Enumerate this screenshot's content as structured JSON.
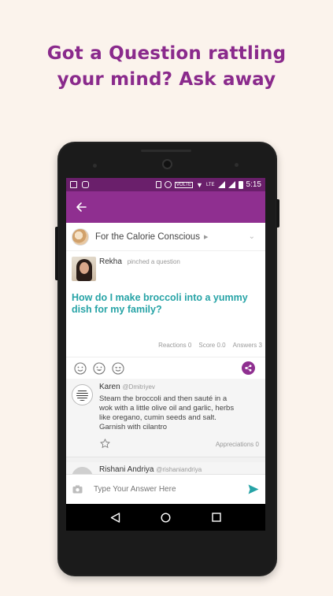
{
  "promo": {
    "line1": "Got a Question rattling",
    "line2": "your mind? Ask away"
  },
  "status_bar": {
    "time": "5:15",
    "network": "LTE",
    "volte": "VOLTE"
  },
  "app_bar": {
    "back_icon": "arrow-back-icon"
  },
  "category": {
    "name": "For the Calorie Conscious"
  },
  "post": {
    "user": "Rekha",
    "action": "pinched a question",
    "question": "How do I make broccoli into a yummy dish for my family?",
    "stats": {
      "reactions_label": "Reactions",
      "reactions_value": "0",
      "score_label": "Score",
      "score_value": "0.0",
      "answers_label": "Answers",
      "answers_value": "3"
    }
  },
  "answers": [
    {
      "name": "Karen",
      "handle": "@Dmitriyev",
      "text": "Steam the broccoli and then sauté in a wok with a little olive oil and garlic, herbs like oregano, cumin seeds and salt. Garnish with cilantro",
      "appreciations_label": "Appreciations",
      "appreciations_value": "0"
    },
    {
      "name": "Rishani Andriya",
      "handle": "@rishaniandriya"
    }
  ],
  "composer": {
    "placeholder": "Type Your Answer Here"
  },
  "colors": {
    "brand_purple": "#8f2f90",
    "status_purple": "#6a1f6b",
    "question_teal": "#26a3a6",
    "background": "#fbf3ec"
  }
}
